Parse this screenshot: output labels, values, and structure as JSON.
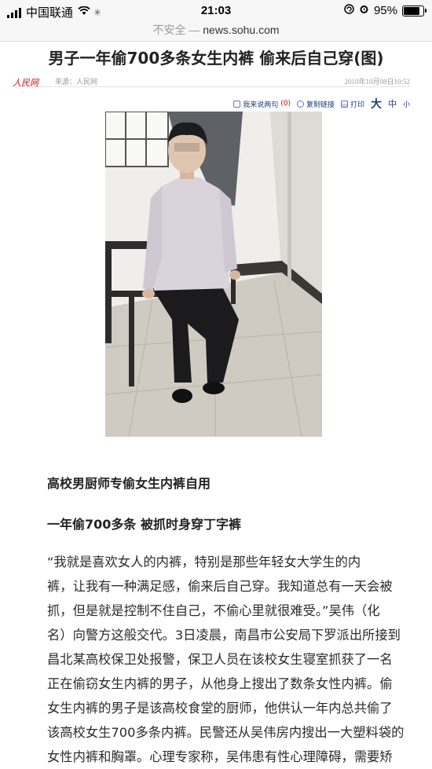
{
  "status_bar": {
    "carrier": "中国联通",
    "time": "21:03",
    "battery_percent": "95%",
    "battery_level": 0.95
  },
  "url_bar": {
    "security": "不安全",
    "separator": "—",
    "domain": "news.sohu.com"
  },
  "article": {
    "title": "男子一年偷700多条女生内裤 偷来后自己穿(图)",
    "logo_text": "人民网",
    "source": "来源：人民网",
    "datetime": "2010年10月08日10:52",
    "tools": {
      "comment_label": "我来说两句",
      "comment_count": "(0)",
      "copy_label": "复制链接",
      "print_label": "打印",
      "size_large": "大",
      "size_medium": "中",
      "size_small": "小"
    },
    "subheading1": "高校男厨师专偷女生内裤自用",
    "subheading2": "一年偷700多条 被抓时身穿丁字裤",
    "body_lines": [
      "“我就是喜欢女人的内裤，特别是那些年轻女大学生的内",
      "裤，让我有一种满足感，偷来后自己穿。我知道总有一天会被",
      "抓，但是就是控制不住自己，不偷心里就很难受。”吴伟（化",
      "名）向警方这般交代。3日凌晨，南昌市公安局下罗派出所接到",
      "昌北某高校保卫处报警，保卫人员在该校女生寝室抓获了一名",
      "正在偷窃女生内裤的男子，从他身上搜出了数条女性内裤。偷",
      "女生内裤的男子是该高校食堂的厨师，他供认一年内总共偷了",
      "该高校女生700多条内裤。民警还从吴伟房内搜出一大塑料袋的",
      "女性内裤和胸罩。心理专家称，吴伟患有性心理障碍，需要矫"
    ]
  }
}
